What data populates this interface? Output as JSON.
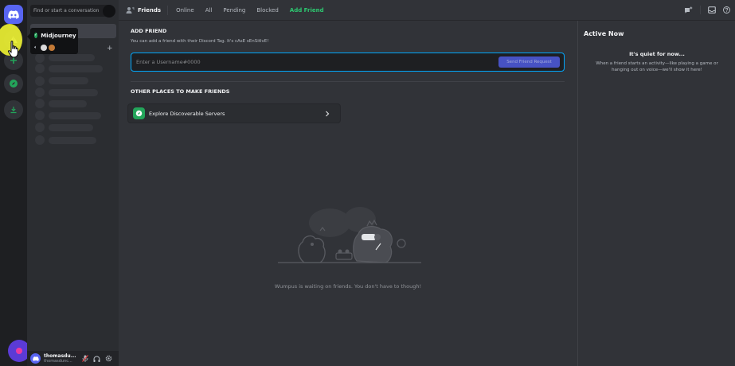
{
  "colors": {
    "accent": "#5865f2",
    "online_green": "#23a55a",
    "add_friend_green": "#2dc770",
    "highlight_yellow": "#ecf032",
    "input_border": "#00a8fc"
  },
  "rail": {
    "icons": [
      "discord-home-icon",
      "midjourney-server-icon",
      "add-server-icon",
      "explore-icon",
      "download-icon"
    ]
  },
  "sidebar": {
    "search_placeholder": "Find or start a conversation",
    "dm_add_icon": "plus-icon"
  },
  "tooltip": {
    "server_name": "Midjourney"
  },
  "user_panel": {
    "username": "thomasdu...",
    "tag": "thomasdunc..."
  },
  "topbar": {
    "title": "Friends",
    "tabs": [
      "Online",
      "All",
      "Pending",
      "Blocked"
    ],
    "add_friend": "Add Friend"
  },
  "add_friend": {
    "heading": "ADD FRIEND",
    "description": "You can add a friend with their Discord Tag. It's cAsE sEnSitIvE!",
    "input_placeholder": "Enter a Username#0000",
    "button_label": "Send Friend Request"
  },
  "other_places": {
    "heading": "OTHER PLACES TO MAKE FRIENDS",
    "explore_label": "Explore Discoverable Servers"
  },
  "empty_state": {
    "caption": "Wumpus is waiting on friends. You don't have to though!"
  },
  "active_now": {
    "title": "Active Now",
    "quiet_title": "It's quiet for now...",
    "quiet_desc": "When a friend starts an activity—like playing a game or hanging out on voice—we'll show it here!"
  }
}
